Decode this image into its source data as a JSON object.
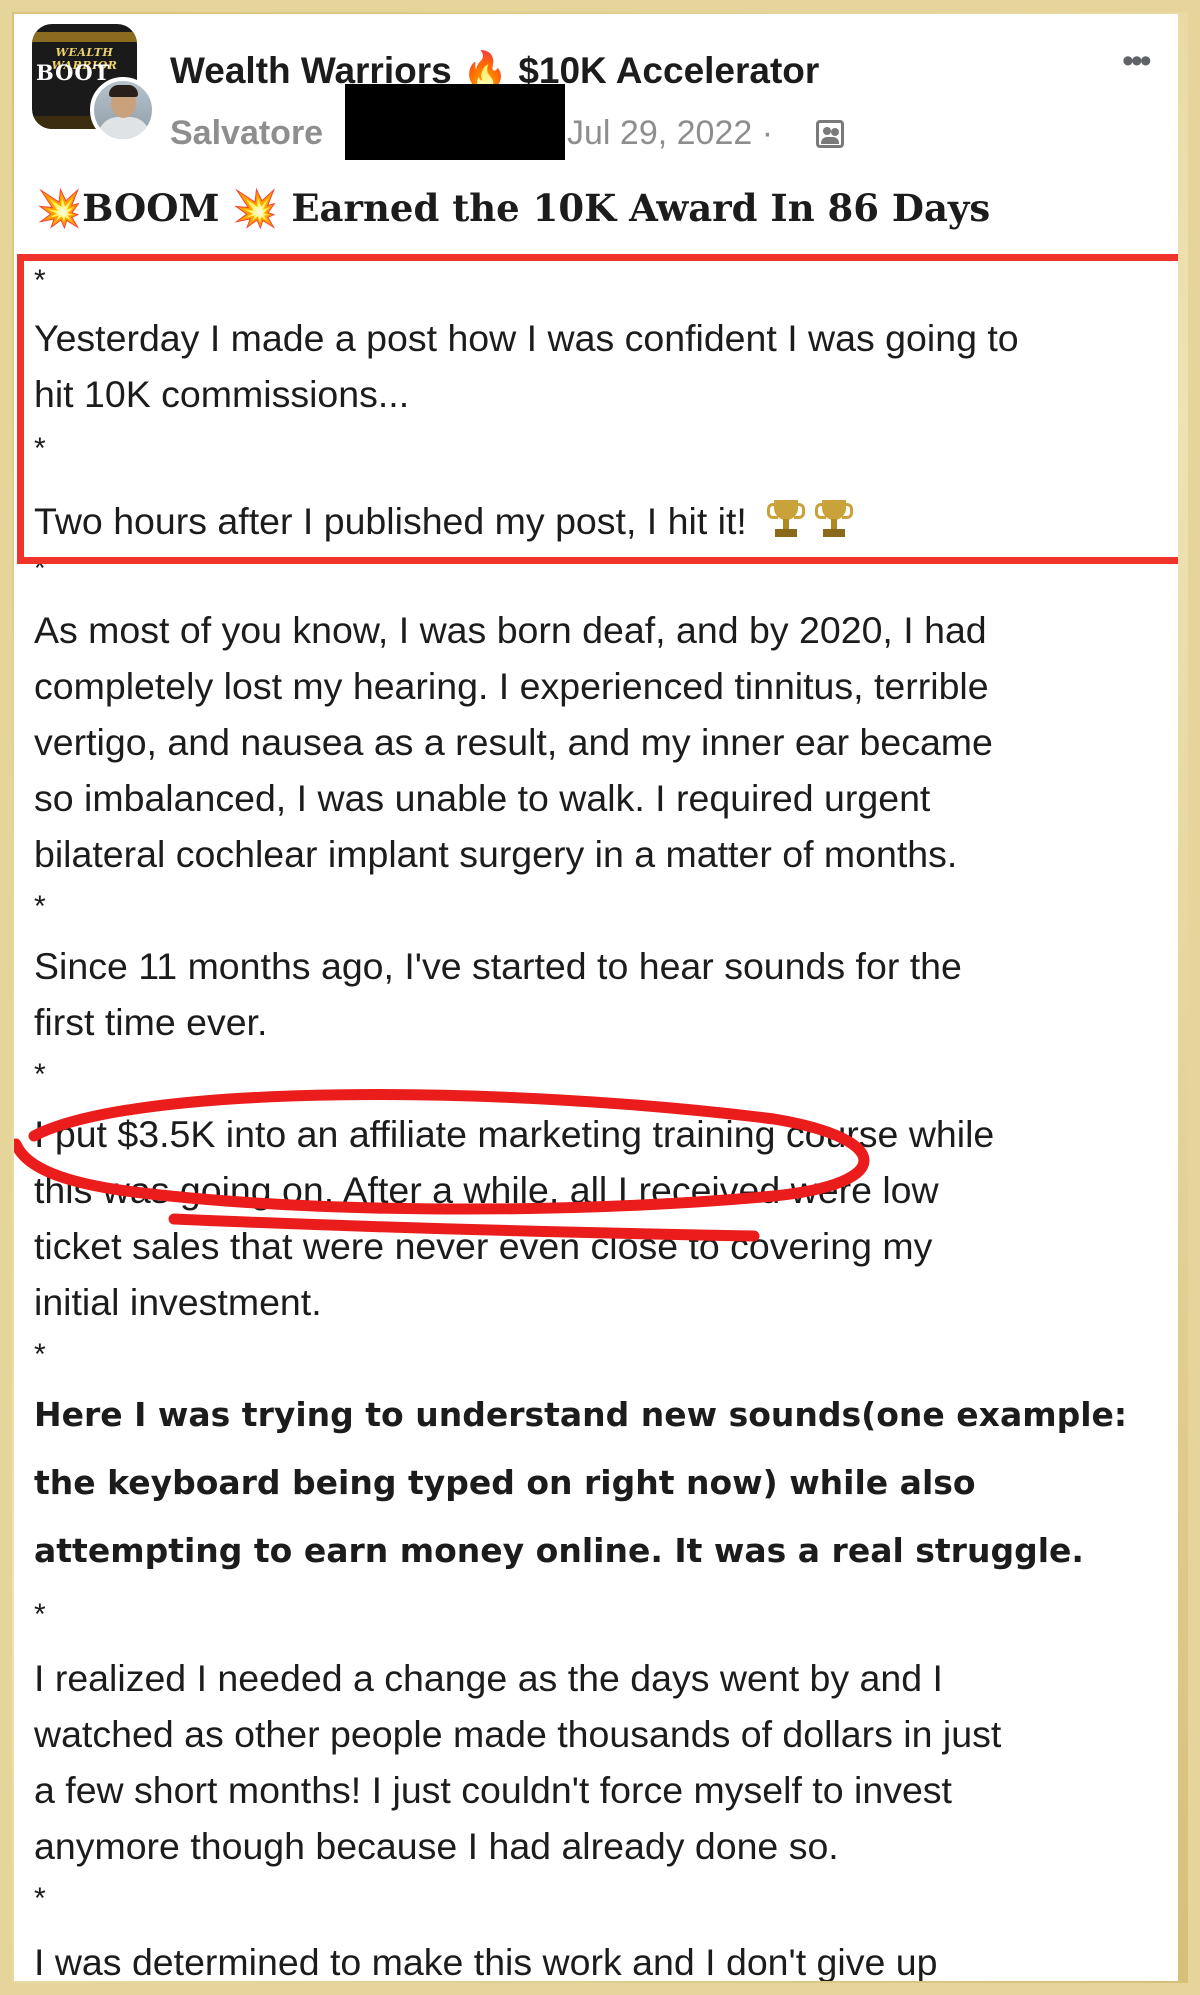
{
  "post": {
    "group_name": "Wealth Warriors",
    "title_suffix": "$10K Accelerator",
    "author": "Salvatore",
    "date": "Jul 29, 2022 ·",
    "group_avatar_text_top": "WEALTH WARRIOR",
    "group_avatar_text": "BOOT",
    "headline": "BOOM",
    "headline_rest": "Earned the 10K Award In 86 Days"
  },
  "icons": {
    "fire": "🔥",
    "boom": "💥",
    "menu": "•••",
    "privacy": "group-members-icon",
    "trophy": "trophy-icon"
  },
  "colors": {
    "highlight_border": "#f0342b",
    "scribble": "#ea1c1c",
    "frame": "#e6d59a"
  },
  "body": {
    "star": "*",
    "l1": "Yesterday I made a post how I was confident I was going to",
    "l2": "hit 10K commissions...",
    "l3": "Two hours after I published my post, I hit it!",
    "p1_l1": "As most of you know, I was born deaf, and by 2020, I had",
    "p1_l2": "completely lost my hearing. I experienced tinnitus, terrible",
    "p1_l3": "vertigo, and nausea as a result, and my inner ear became",
    "p1_l4": "so imbalanced, I was unable to walk. I required urgent",
    "p1_l5": "bilateral cochlear implant surgery in a matter of months.",
    "p2_l1": "Since 11 months ago, I've started to hear sounds for the",
    "p2_l2": "first time ever.",
    "p3_l1": "I put $3.5K into an affiliate marketing training course while",
    "p3_l2": "this was going on. After a while, all I received were low",
    "p3_l3": "ticket sales that were never even close to covering my",
    "p3_l4": "initial investment.",
    "p4_l1": "Here I was trying to understand new sounds(one example:",
    "p4_l2": "the keyboard being typed on right now) while also",
    "p4_l3": "attempting to earn money online. It was a real struggle.",
    "p5_l1": "I realized I needed a change as the days went by and I",
    "p5_l2": "watched as other people made thousands of dollars in just",
    "p5_l3": "a few short months! I just couldn't force myself to invest",
    "p5_l4": "anymore though because I had already done so.",
    "p6_l1": "I was determined to make this work and I don't give up"
  }
}
